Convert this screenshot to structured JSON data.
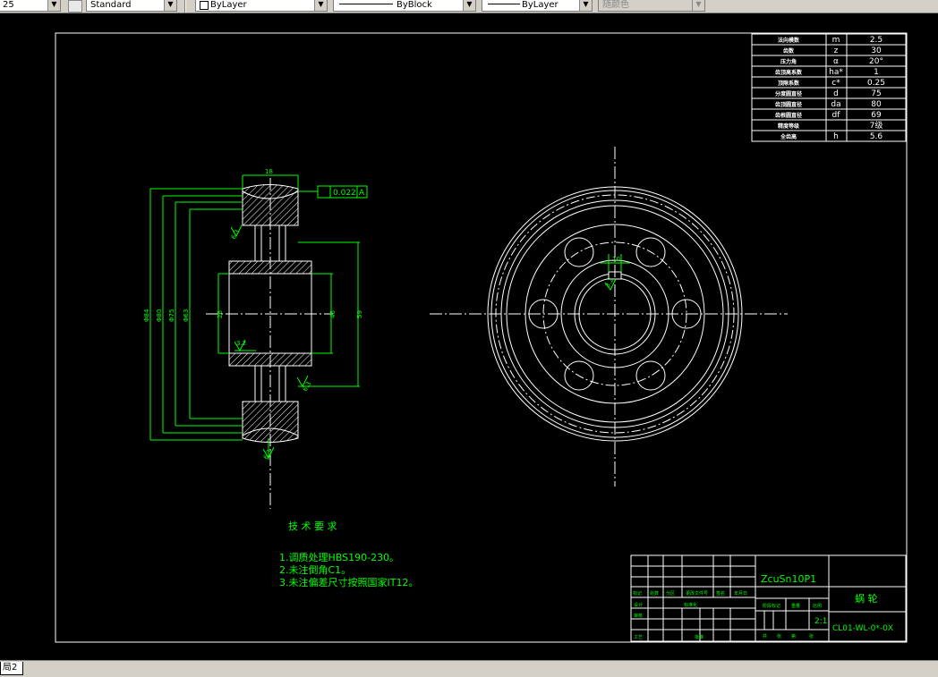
{
  "toolbar": {
    "dimstyle_label": "25",
    "textstyle_label": "Standard",
    "layer_label": "ByLayer",
    "linetype_label": "ByBlock",
    "lineweight_label": "ByLayer",
    "plotstyle_label": "随颜色"
  },
  "layout_tab_label": "局2",
  "colors": {
    "cad_bg": "#000000",
    "border_white": "#ffffff",
    "annotation_green": "#00ff00"
  },
  "table": {
    "rows": [
      {
        "name": "法向模数",
        "sym": "m",
        "val": "2.5"
      },
      {
        "name": "齿数",
        "sym": "z",
        "val": "30"
      },
      {
        "name": "压力角",
        "sym": "α",
        "val": "20°"
      },
      {
        "name": "齿顶高系数",
        "sym": "ha*",
        "val": "1"
      },
      {
        "name": "顶隙系数",
        "sym": "c*",
        "val": "0.25"
      },
      {
        "name": "分度圆直径",
        "sym": "d",
        "val": "75"
      },
      {
        "name": "齿顶圆直径",
        "sym": "da",
        "val": "80"
      },
      {
        "name": "齿根圆直径",
        "sym": "df",
        "val": "69"
      },
      {
        "name": "精度等级",
        "sym": "",
        "val": "7级"
      },
      {
        "name": "全齿高",
        "sym": "h",
        "val": "5.6"
      }
    ]
  },
  "dims": {
    "width_top": "18",
    "tol": "0.022",
    "datum": "A",
    "d84": "Φ84",
    "d80": "Φ80",
    "d75": "Φ75",
    "d63": "Φ63",
    "d26": "26",
    "d46": "46",
    "d59": "59",
    "r1": "3.2",
    "r2": "6.3",
    "r3": "6.3",
    "r4": "6.3",
    "keyway": "10",
    "key_rough": "3.2"
  },
  "notes": {
    "title": "技 术 要 求",
    "items": [
      "1.调质处理HBS190-230。",
      "2.未注倒角C1。",
      "3.未注偏差尺寸按照国家IT12。"
    ]
  },
  "titleblock": {
    "material": "ZcuSn10P1",
    "part_name": "蜗 轮",
    "scale": "2:1",
    "drawing_no": "CL01-WL-0*-0X",
    "headers": [
      "标记",
      "处数",
      "分区",
      "更改文件号",
      "签名",
      "年月日"
    ],
    "left_labels": [
      "设计",
      "审核",
      "工艺"
    ],
    "std_label": "标准化",
    "approve_label": "批准",
    "stage_label": "阶段标记",
    "weight_label": "重量",
    "scale_label": "比例",
    "bottom_labels": [
      "共",
      "张",
      "第",
      "张"
    ]
  }
}
